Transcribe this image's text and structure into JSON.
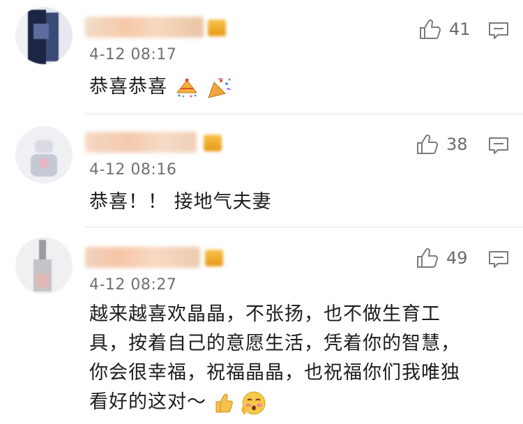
{
  "comments": [
    {
      "timestamp": "4-12 08:17",
      "text": "恭喜恭喜",
      "likes": "41",
      "emojis": [
        "party-hat-emoji",
        "party-popper-emoji"
      ]
    },
    {
      "timestamp": "4-12 08:16",
      "text": "恭喜！！ 接地气夫妻",
      "likes": "38",
      "emojis": []
    },
    {
      "timestamp": "4-12 08:27",
      "text_lines": [
        "越来越喜欢晶晶，不张扬，也不做生育工",
        "具，按着自己的意愿生活，凭着你的智慧，",
        "你会很幸福，祝福晶晶，也祝福你们我唯独",
        "看好的这对～"
      ],
      "likes": "49",
      "emojis": [
        "thumbs-up-emoji",
        "blushing-face-emoji"
      ]
    }
  ],
  "colors": {
    "vip_badge": "#e9a01c",
    "meta_text": "#707070",
    "icon_stroke": "#7a7a7a",
    "divider": "#e3e3e3"
  },
  "icons": [
    "thumbs-up-icon",
    "comment-reply-icon",
    "vip-badge-icon"
  ]
}
